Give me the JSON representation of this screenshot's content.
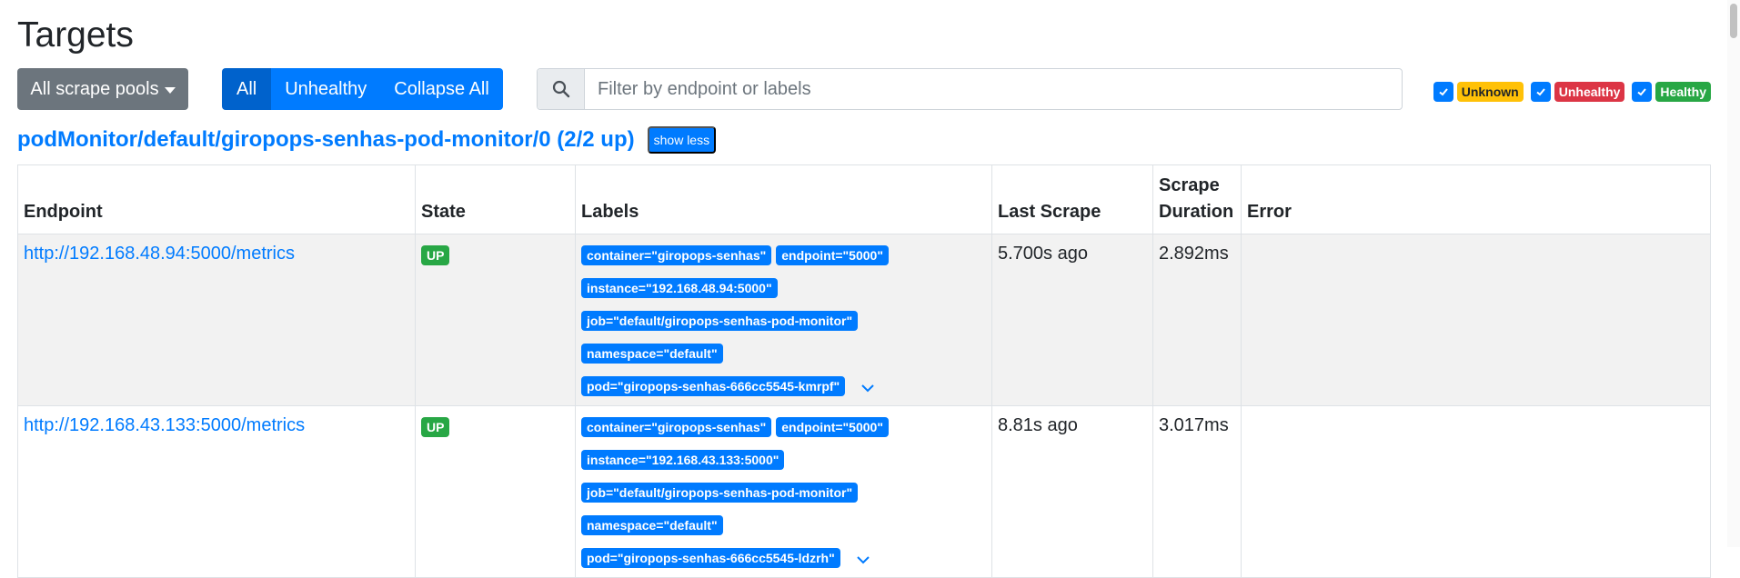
{
  "page": {
    "title": "Targets"
  },
  "toolbar": {
    "pools_label": "All scrape pools",
    "filter_all": "All",
    "filter_unhealthy": "Unhealthy",
    "collapse_all": "Collapse All",
    "search_placeholder": "Filter by endpoint or labels"
  },
  "health_filters": {
    "unknown": "Unknown",
    "unhealthy": "Unhealthy",
    "healthy": "Healthy"
  },
  "pool": {
    "title": "podMonitor/default/giropops-senhas-pod-monitor/0 (2/2 up)",
    "toggle_label": "show less"
  },
  "table": {
    "headers": {
      "endpoint": "Endpoint",
      "state": "State",
      "labels": "Labels",
      "last_scrape": "Last Scrape",
      "scrape_duration": "Scrape Duration",
      "error": "Error"
    },
    "rows": [
      {
        "endpoint": "http://192.168.48.94:5000/metrics",
        "state": "UP",
        "labels": {
          "container": "container=\"giropops-senhas\"",
          "endpoint": "endpoint=\"5000\"",
          "instance": "instance=\"192.168.48.94:5000\"",
          "job": "job=\"default/giropops-senhas-pod-monitor\"",
          "namespace": "namespace=\"default\"",
          "pod": "pod=\"giropops-senhas-666cc5545-kmrpf\""
        },
        "last_scrape": "5.700s ago",
        "scrape_duration": "2.892ms",
        "error": ""
      },
      {
        "endpoint": "http://192.168.43.133:5000/metrics",
        "state": "UP",
        "labels": {
          "container": "container=\"giropops-senhas\"",
          "endpoint": "endpoint=\"5000\"",
          "instance": "instance=\"192.168.43.133:5000\"",
          "job": "job=\"default/giropops-senhas-pod-monitor\"",
          "namespace": "namespace=\"default\"",
          "pod": "pod=\"giropops-senhas-666cc5545-ldzrh\""
        },
        "last_scrape": "8.81s ago",
        "scrape_duration": "3.017ms",
        "error": ""
      }
    ]
  },
  "colors": {
    "primary": "#007bff",
    "secondary": "#6c757d",
    "success": "#28a745",
    "warning": "#ffc107",
    "danger": "#dc3545"
  },
  "icons": {
    "search": "search-icon",
    "checkbox": "checkmark-icon",
    "expand": "chevron-down-icon",
    "dropdown": "caret-down-icon"
  }
}
